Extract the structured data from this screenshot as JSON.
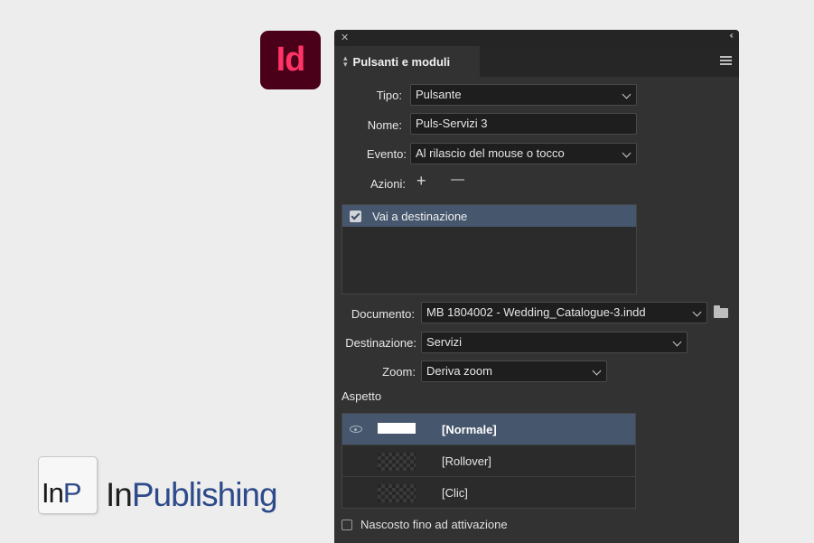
{
  "app_icon": {
    "label": "Id"
  },
  "panel": {
    "title": "Pulsanti e moduli",
    "tipo": {
      "label": "Tipo:",
      "value": "Pulsante"
    },
    "nome": {
      "label": "Nome:",
      "value": "Puls-Servizi 3"
    },
    "evento": {
      "label": "Evento:",
      "value": "Al rilascio del mouse o tocco"
    },
    "azioni": {
      "label": "Azioni:",
      "add": "+",
      "remove": "—"
    },
    "actions_list": [
      {
        "label": "Vai a destinazione",
        "checked": true
      }
    ],
    "documento": {
      "label": "Documento:",
      "value": "MB 1804002 - Wedding_Catalogue-3.indd"
    },
    "destinazione": {
      "label": "Destinazione:",
      "value": "Servizi"
    },
    "zoom": {
      "label": "Zoom:",
      "value": "Deriva zoom"
    },
    "aspetto": {
      "title": "Aspetto",
      "states": [
        {
          "label": "[Normale]",
          "selected": true
        },
        {
          "label": "[Rollover]",
          "selected": false
        },
        {
          "label": "[Clic]",
          "selected": false
        }
      ]
    },
    "hidden_until_triggered": {
      "label": "Nascosto fino ad attivazione",
      "checked": false
    }
  },
  "brand": {
    "logo_in": "In",
    "logo_p": "P",
    "word_in": "In",
    "word_publishing": "Publishing",
    "accent": "#2d4a8a"
  },
  "colors": {
    "panel_bg": "#323232",
    "selection": "#45566d",
    "indesign_red": "#ff3366",
    "indesign_bg": "#4a0019"
  }
}
